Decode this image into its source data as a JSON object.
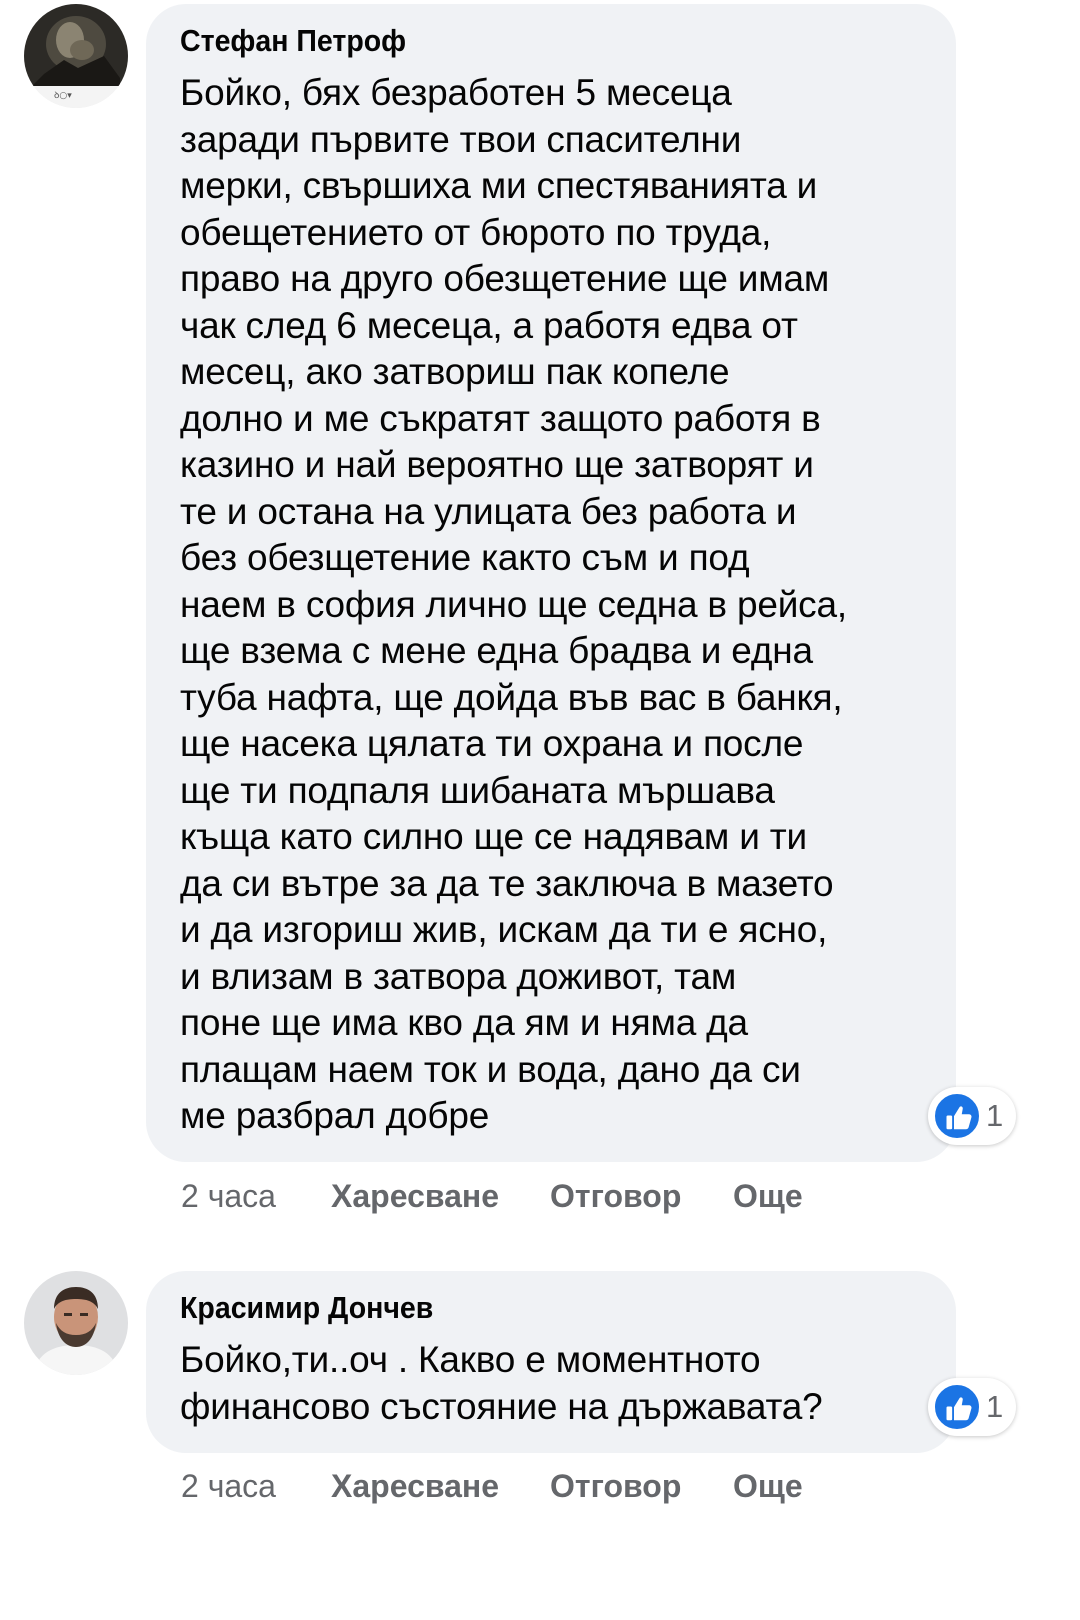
{
  "comments": [
    {
      "author": "Стефан Петроф",
      "text": "Бойко, бях безработен 5 месеца\nзаради първите твои спасителни\nмерки, свършиха ми спестяванията и\nобещетението от бюрото по труда,\nправо на друго обезщетение ще имам\nчак след 6 месеца, а работя едва от\nмесец, ако затвориш пак копеле\nдолно и ме съкратят защото работя в\nказино и най вероятно ще затворят и\nте и остана на улицата без работа и\nбез обезщетение както съм и под\nнаем в софия лично ще седна в рейса,\nще взема с мене една брадва и една\nтуба нафта, ще дойда във вас в банкя,\nще насека цялата ти охрана и после\nще ти подпаля шибаната мършава\nкъща като силно ще се надявам и ти\nда си вътре за да те заключа в мазето\nи да изгориш жив, искам да ти е ясно,\nи влизам в затвора доживот, там\nпоне ще има кво да ям и няма да\nплащам наем ток и вода, дано да си\nме разбрал добре",
      "reaction_count": "1",
      "time": "2 часа",
      "like_label": "Харесване",
      "reply_label": "Отговор",
      "more_label": "Още"
    },
    {
      "author": "Красимир Дончев",
      "text": "Бойко,ти..оч . Какво е моментното\nфинансово състояние на държавата?",
      "reaction_count": "1",
      "time": "2 часа",
      "like_label": "Харесване",
      "reply_label": "Отговор",
      "more_label": "Още"
    }
  ],
  "icons": {
    "reaction": "like-thumbs-up-icon",
    "avatar_1": "user-avatar-dark-photo",
    "avatar_2": "user-avatar-man-portrait"
  },
  "colors": {
    "bubble_bg": "#f0f2f5",
    "like_blue": "#1b74e4",
    "secondary_text": "#65676b"
  }
}
